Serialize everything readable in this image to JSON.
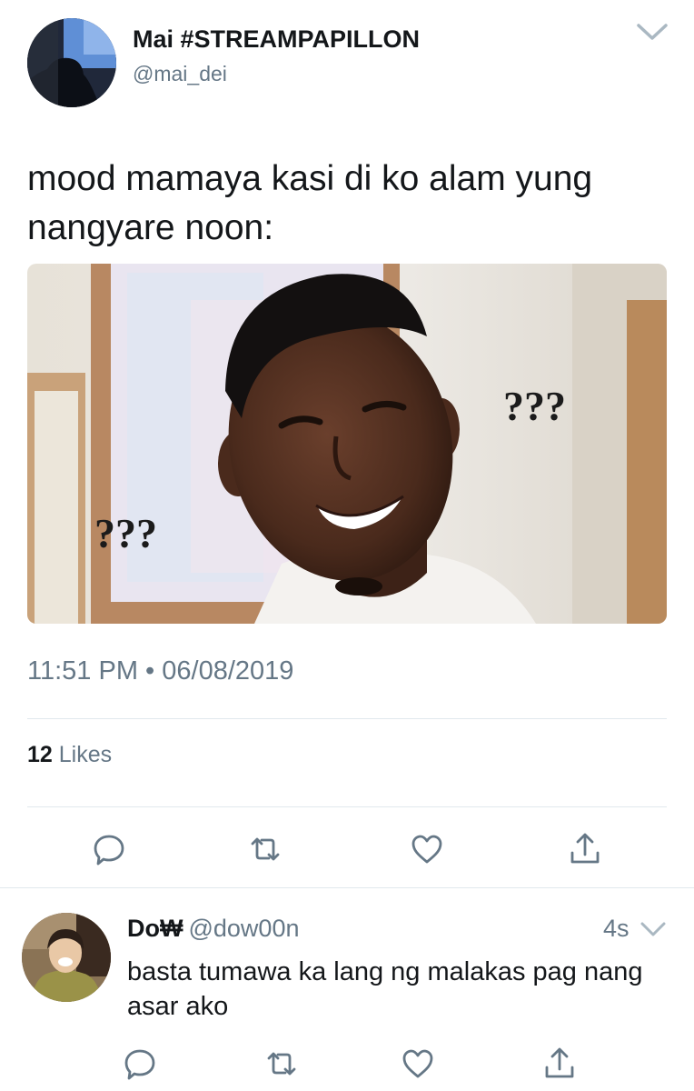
{
  "tweet": {
    "display_name": "Mai #STREAMPAPILLON",
    "handle": "@mai_dei",
    "text": "mood mamaya kasi di ko alam yung nangyare noon:",
    "media_labels": {
      "left": "???",
      "right": "???"
    },
    "time": "11:51 PM",
    "separator": "•",
    "date": "06/08/2019",
    "likes_count": "12",
    "likes_label": "Likes",
    "actions": [
      "reply-icon",
      "retweet-icon",
      "like-icon",
      "share-icon"
    ]
  },
  "reply": {
    "display_name": "Do₩",
    "handle": "@dow00n",
    "time": "4s",
    "text": "basta tumawa ka lang ng malakas pag nang asar ako",
    "actions": [
      "reply-icon",
      "retweet-icon",
      "like-icon",
      "share-icon"
    ]
  },
  "colors": {
    "text_primary": "#14171a",
    "text_secondary": "#657786",
    "divider": "#e1e8ed"
  }
}
